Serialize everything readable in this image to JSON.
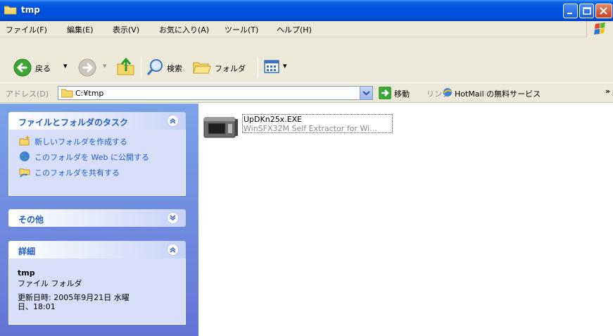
{
  "window": {
    "title": "tmp"
  },
  "menu": [
    "ファイル(F)",
    "編集(E)",
    "表示(V)",
    "お気に入り(A)",
    "ツール(T)",
    "ヘルプ(H)"
  ],
  "toolbar": {
    "back_label": "戻る",
    "search_label": "検索",
    "folders_label": "フォルダ"
  },
  "address": {
    "label": "アドレス(D)",
    "value": "C:¥tmp",
    "go_label": "移動",
    "links_label": "リンク",
    "hotmail_label": "HotMail の無料サービス",
    "more": "»"
  },
  "taskpane": {
    "tasks_title": "ファイルとフォルダのタスク",
    "tasks": [
      "新しいフォルダを作成する",
      "このフォルダを Web に公開する",
      "このフォルダを共有する"
    ],
    "other_title": "その他",
    "details_title": "詳細",
    "details_name": "tmp",
    "details_type": "ファイル フォルダ",
    "details_date_line1": "更新日時: 2005年9月21日 水曜",
    "details_date_line2": "日、18:01"
  },
  "files": [
    {
      "name": "UpDKn25x.EXE",
      "description": "WinSFX32M Self Extractor for Wi..."
    }
  ],
  "colors": {
    "title_bar": "#0054e3",
    "taskpane_bg": "#7ba2e7",
    "task_link": "#215dc6"
  }
}
